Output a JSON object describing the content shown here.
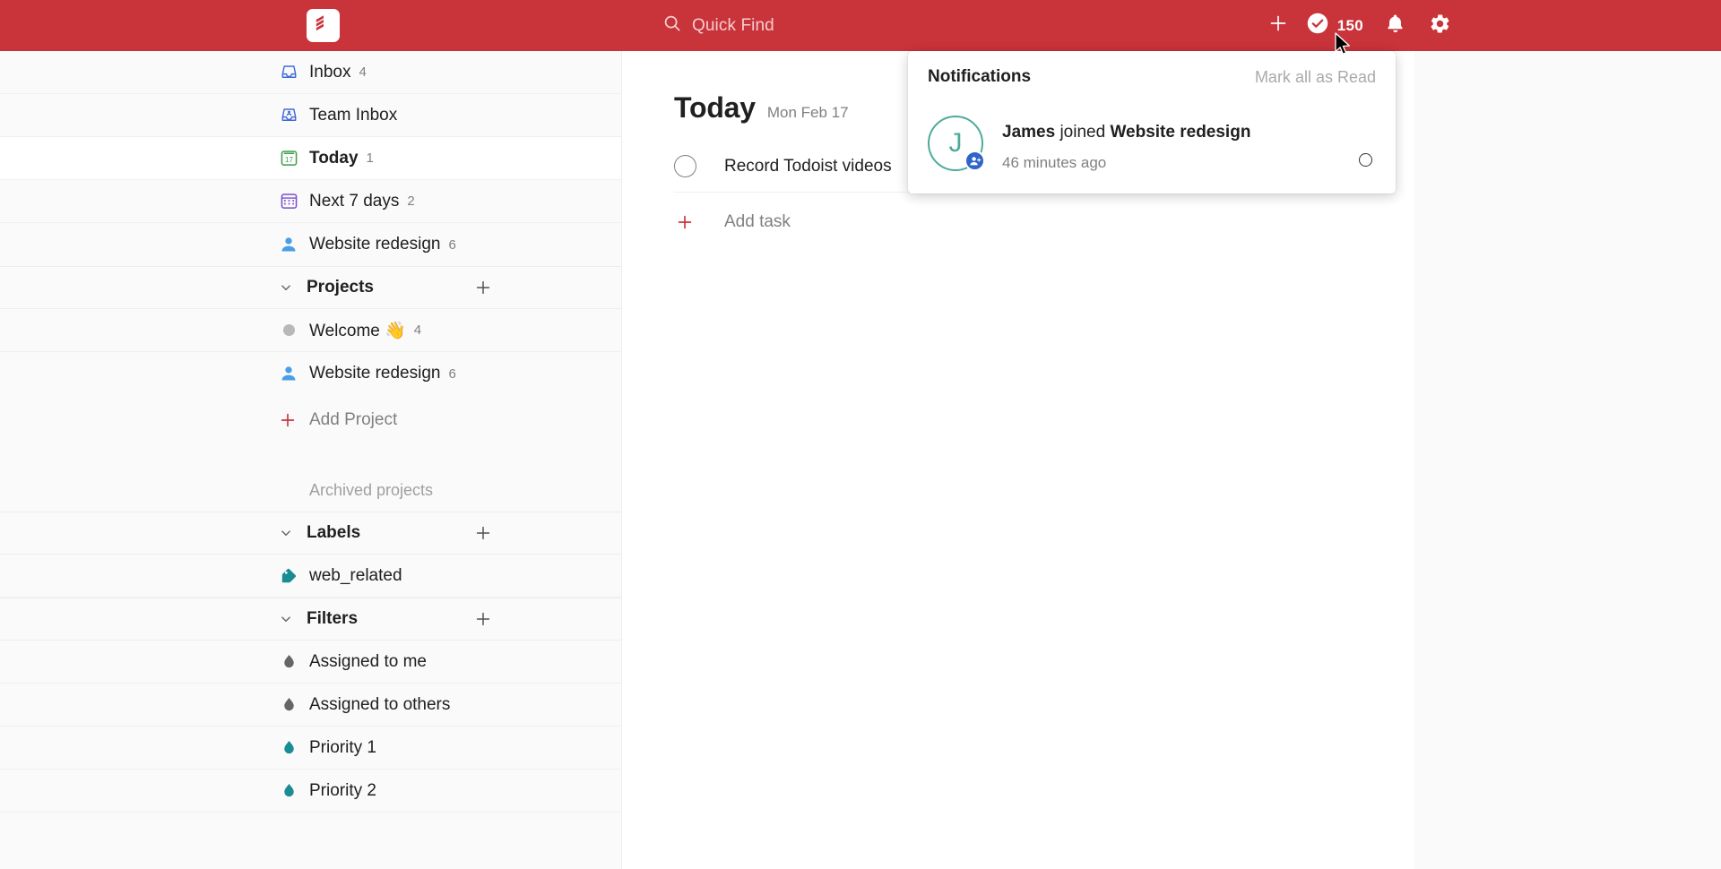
{
  "app": {
    "name": "Todoist",
    "brand_color": "#c9333a",
    "logo_icon": "todoist-logo-icon"
  },
  "topbar": {
    "search": {
      "label": "Quick Find",
      "icon": "search-icon"
    },
    "add_icon": "plus-icon",
    "karma": {
      "icon": "check-circle-icon",
      "value": "150"
    },
    "notifications_icon": "bell-icon",
    "settings_icon": "gear-icon"
  },
  "sidebar": {
    "nav": [
      {
        "label": "Inbox",
        "count": "4",
        "icon": "inbox-icon",
        "icon_color": "#3f6ad8",
        "active": false
      },
      {
        "label": "Team Inbox",
        "count": "",
        "icon": "team-inbox-icon",
        "icon_color": "#3f6ad8",
        "active": false
      },
      {
        "label": "Today",
        "count": "1",
        "icon": "calendar-today-icon",
        "icon_color": "#3d9c4a",
        "active": true
      },
      {
        "label": "Next 7 days",
        "count": "2",
        "icon": "calendar-week-icon",
        "icon_color": "#7c4dcd",
        "active": false
      },
      {
        "label": "Website redesign",
        "count": "6",
        "icon": "person-icon",
        "icon_color": "#4a9ee8",
        "active": false
      }
    ],
    "projects": {
      "title": "Projects",
      "collapse_icon": "chevron-down-icon",
      "add_icon": "plus-icon",
      "items": [
        {
          "label": "Welcome 👋",
          "count": "4",
          "icon": "project-dot-icon",
          "icon_color": "#b8b8b8"
        },
        {
          "label": "Website redesign",
          "count": "6",
          "icon": "person-icon",
          "icon_color": "#4a9ee8"
        }
      ],
      "add_project_label": "Add Project",
      "add_project_icon": "plus-icon",
      "archived_label": "Archived projects"
    },
    "labels": {
      "title": "Labels",
      "collapse_icon": "chevron-down-icon",
      "add_icon": "plus-icon",
      "items": [
        {
          "label": "web_related",
          "icon": "tag-icon",
          "icon_color": "#1a8c93"
        }
      ]
    },
    "filters": {
      "title": "Filters",
      "collapse_icon": "chevron-down-icon",
      "add_icon": "plus-icon",
      "items": [
        {
          "label": "Assigned to me",
          "icon": "filter-drop-icon",
          "icon_color": "#666666"
        },
        {
          "label": "Assigned to others",
          "icon": "filter-drop-icon",
          "icon_color": "#666666"
        },
        {
          "label": "Priority 1",
          "icon": "filter-drop-icon",
          "icon_color": "#1a8c93"
        },
        {
          "label": "Priority 2",
          "icon": "filter-drop-icon",
          "icon_color": "#1a8c93"
        }
      ]
    }
  },
  "main": {
    "title": "Today",
    "date": "Mon Feb 17",
    "tasks": [
      {
        "title": "Record Todoist videos",
        "checkbox_icon": "task-checkbox-icon",
        "completed": false
      }
    ],
    "add_task": {
      "label": "Add task",
      "icon": "plus-icon"
    }
  },
  "notifications": {
    "title": "Notifications",
    "mark_all_label": "Mark all as Read",
    "items": [
      {
        "avatar_initial": "J",
        "avatar_color": "#4cab9a",
        "badge_icon": "person-add-icon",
        "badge_color": "#2f64c8",
        "actor": "James",
        "verb": "joined",
        "target": "Website redesign",
        "time": "46 minutes ago",
        "unread": true
      }
    ]
  }
}
